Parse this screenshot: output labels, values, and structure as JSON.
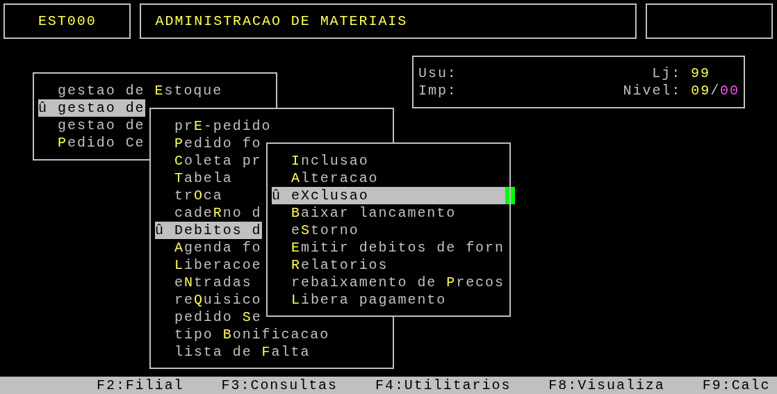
{
  "header": {
    "program_code": "EST000",
    "title": "ADMINISTRACAO DE MATERIAIS"
  },
  "info": {
    "user_label": "Usu:",
    "printer_label": "Imp:",
    "store_label": "Lj:",
    "store_value": "99",
    "level_label": "Nivel:",
    "level_value": "09",
    "level_sep": "/",
    "level_sub": "00"
  },
  "menus": [
    {
      "items": [
        {
          "pre": "gestao de ",
          "key": "E",
          "post": "stoque",
          "selected": false
        },
        {
          "marker": "û",
          "pre": "gestao de",
          "selected": true
        },
        {
          "pre": "gestao de",
          "selected": false
        },
        {
          "key": "P",
          "post": "edido Ce",
          "selected": false
        }
      ]
    },
    {
      "items": [
        {
          "pre": "pr",
          "key": "E",
          "post": "-pedido",
          "selected": false
        },
        {
          "key": "P",
          "post": "edido fo",
          "selected": false
        },
        {
          "key": "C",
          "post": "oleta pr",
          "selected": false
        },
        {
          "key": "T",
          "post": "abela",
          "selected": false
        },
        {
          "pre": "tr",
          "key": "O",
          "post": "ca",
          "selected": false
        },
        {
          "pre": "cade",
          "key": "R",
          "post": "no d",
          "selected": false
        },
        {
          "marker": "û",
          "pre": "Debitos d",
          "selected": true
        },
        {
          "key": "A",
          "post": "genda fo",
          "selected": false
        },
        {
          "key": "L",
          "post": "iberacoe",
          "selected": false
        },
        {
          "pre": "e",
          "key": "N",
          "post": "tradas",
          "selected": false
        },
        {
          "pre": "re",
          "key": "Q",
          "post": "uisico",
          "selected": false
        },
        {
          "pre": "pedido ",
          "key": "S",
          "post": "e",
          "selected": false
        },
        {
          "pre": "tipo ",
          "key": "B",
          "post": "onificacao",
          "selected": false
        },
        {
          "pre": "lista de ",
          "key": "F",
          "post": "alta",
          "selected": false
        }
      ]
    },
    {
      "items": [
        {
          "key": "I",
          "post": "nclusao",
          "selected": false
        },
        {
          "key": "A",
          "post": "lteracao",
          "selected": false
        },
        {
          "marker": "û",
          "pre": "eXclusao",
          "selected": true
        },
        {
          "key": "B",
          "post": "aixar lancamento",
          "selected": false
        },
        {
          "pre": "e",
          "key": "S",
          "post": "torno",
          "selected": false
        },
        {
          "key": "E",
          "post": "mitir debitos de forn",
          "selected": false
        },
        {
          "key": "R",
          "post": "elatorios",
          "selected": false
        },
        {
          "pre": "rebaixamento de ",
          "key": "P",
          "post": "recos",
          "selected": false
        },
        {
          "key": "L",
          "post": "ibera pagamento",
          "selected": false
        }
      ]
    }
  ],
  "status_bar": [
    "F2:Filial",
    "F3:Consultas",
    "F4:Utilitarios",
    "F8:Visualiza",
    "F9:Calc"
  ]
}
